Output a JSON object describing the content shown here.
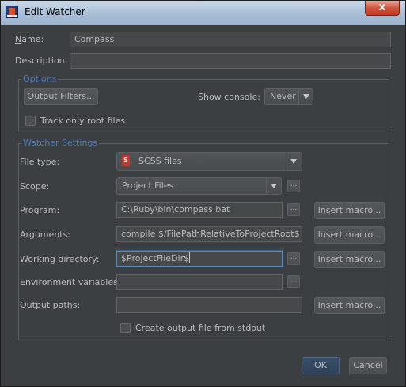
{
  "window": {
    "title": "Edit Watcher",
    "close_glyph": "x"
  },
  "form": {
    "name": {
      "label": "Name:",
      "value": "Compass"
    },
    "description": {
      "label": "Description:",
      "value": ""
    }
  },
  "options": {
    "title": "Options",
    "output_filters_label": "Output Filters...",
    "show_console_label": "Show console:",
    "show_console_value": "Never",
    "track_root_label": "Track only root files",
    "track_root_checked": false
  },
  "watcher": {
    "title": "Watcher Settings",
    "file_type": {
      "label": "File type:",
      "value": "SCSS files",
      "icon": "sass-file-icon"
    },
    "scope": {
      "label": "Scope:",
      "value": "Project Files"
    },
    "program": {
      "label": "Program:",
      "value": "C:\\Ruby\\bin\\compass.bat"
    },
    "arguments": {
      "label": "Arguments:",
      "value": "compile $/FilePathRelativeToProjectRoot$"
    },
    "working_dir": {
      "label": "Working directory:",
      "value": "$ProjectFileDir$"
    },
    "env_vars": {
      "label": "Environment variables:",
      "value": ""
    },
    "output_paths": {
      "label": "Output paths:",
      "value": ""
    },
    "insert_macro_label": "Insert macro...",
    "ellipsis_label": "...",
    "stdout_label": "Create output file from stdout",
    "stdout_checked": false
  },
  "footer": {
    "ok_label": "OK",
    "cancel_label": "Cancel"
  }
}
